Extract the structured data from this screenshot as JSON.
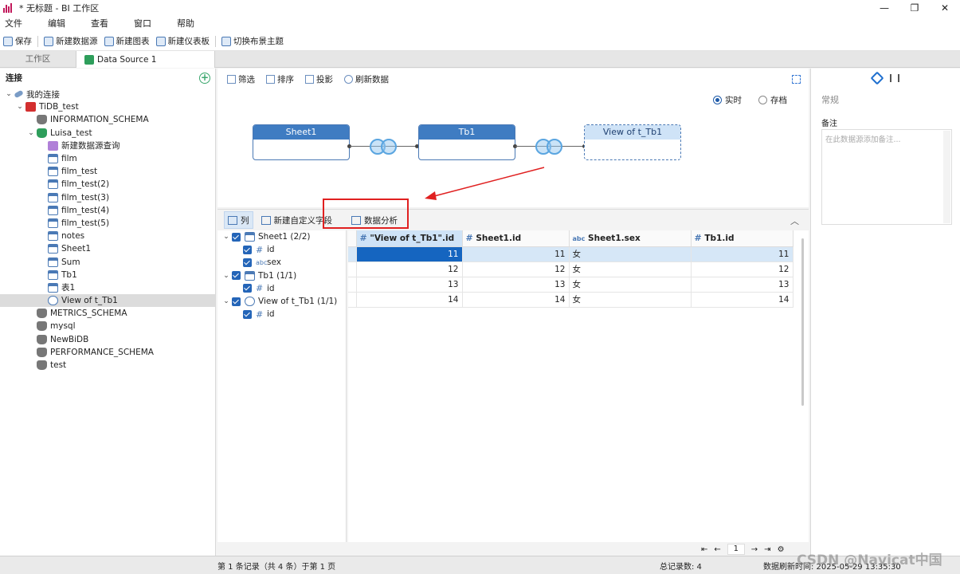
{
  "window": {
    "title": "* 无标题 - BI 工作区",
    "controls": [
      "—",
      "❐",
      "✕"
    ]
  },
  "menu": [
    "文件",
    "编辑",
    "查看",
    "窗口",
    "帮助"
  ],
  "toolbar": {
    "save": "保存",
    "new_datasource": "新建数据源",
    "new_chart": "新建图表",
    "new_dashboard": "新建仪表板",
    "switch_theme": "切换布景主题"
  },
  "tabs": {
    "workspace": "工作区",
    "datasource": "Data Source 1"
  },
  "left": {
    "header": "连接",
    "plus": "+",
    "tree": [
      {
        "label": "我的连接",
        "icon": "connection-icon",
        "level": 0,
        "exp": "⌄"
      },
      {
        "label": "TiDB_test",
        "icon": "tidb-icon",
        "level": 1,
        "exp": "⌄"
      },
      {
        "label": "INFORMATION_SCHEMA",
        "icon": "database-icon",
        "level": 2,
        "exp": ""
      },
      {
        "label": "Luisa_test",
        "icon": "database-green-icon",
        "level": 2,
        "exp": "⌄"
      },
      {
        "label": "新建数据源查询",
        "icon": "query-icon",
        "level": 3,
        "exp": ""
      },
      {
        "label": "film",
        "icon": "table-icon",
        "level": 3,
        "exp": ""
      },
      {
        "label": "film_test",
        "icon": "table-icon",
        "level": 3,
        "exp": ""
      },
      {
        "label": "film_test(2)",
        "icon": "table-icon",
        "level": 3,
        "exp": ""
      },
      {
        "label": "film_test(3)",
        "icon": "table-icon",
        "level": 3,
        "exp": ""
      },
      {
        "label": "film_test(4)",
        "icon": "table-icon",
        "level": 3,
        "exp": ""
      },
      {
        "label": "film_test(5)",
        "icon": "table-icon",
        "level": 3,
        "exp": ""
      },
      {
        "label": "notes",
        "icon": "table-icon",
        "level": 3,
        "exp": ""
      },
      {
        "label": "Sheet1",
        "icon": "table-icon",
        "level": 3,
        "exp": ""
      },
      {
        "label": "Sum",
        "icon": "table-icon",
        "level": 3,
        "exp": ""
      },
      {
        "label": "Tb1",
        "icon": "table-icon",
        "level": 3,
        "exp": ""
      },
      {
        "label": "表1",
        "icon": "table-icon",
        "level": 3,
        "exp": ""
      },
      {
        "label": "View of t_Tb1",
        "icon": "view-icon",
        "level": 3,
        "exp": "",
        "selected": true
      },
      {
        "label": "METRICS_SCHEMA",
        "icon": "database-icon",
        "level": 2,
        "exp": ""
      },
      {
        "label": "mysql",
        "icon": "database-icon",
        "level": 2,
        "exp": ""
      },
      {
        "label": "NewBiDB",
        "icon": "database-icon",
        "level": 2,
        "exp": ""
      },
      {
        "label": "PERFORMANCE_SCHEMA",
        "icon": "database-icon",
        "level": 2,
        "exp": ""
      },
      {
        "label": "test",
        "icon": "database-icon",
        "level": 2,
        "exp": ""
      }
    ]
  },
  "center": {
    "toolbar": {
      "filter": "筛选",
      "sort": "排序",
      "project": "投影",
      "refresh": "刷新数据"
    },
    "mode": {
      "realtime": "实时",
      "archive": "存档",
      "selected": "realtime"
    },
    "nodes": {
      "sheet1": "Sheet1",
      "tb1": "Tb1",
      "view": "View of t_Tb1"
    },
    "lower_toolbar": {
      "columns": "列",
      "new_custom_field": "新建自定义字段",
      "data_analysis": "数据分析",
      "collapse": "︿"
    },
    "fieldtree": [
      {
        "label": "Sheet1 (2/2)",
        "kind": "table",
        "exp": "⌄"
      },
      {
        "label": "id",
        "kind": "num"
      },
      {
        "label": "sex",
        "kind": "str"
      },
      {
        "label": "Tb1 (1/1)",
        "kind": "table",
        "exp": "⌄"
      },
      {
        "label": "id",
        "kind": "num"
      },
      {
        "label": "View of t_Tb1 (1/1)",
        "kind": "view",
        "exp": "⌄"
      },
      {
        "label": "id",
        "kind": "num"
      }
    ],
    "grid": {
      "headers": [
        "\"View of t_Tb1\".id",
        "Sheet1.id",
        "Sheet1.sex",
        "Tb1.id"
      ],
      "header_marks": [
        "#",
        "#",
        "abc",
        "#"
      ],
      "rows": [
        [
          "11",
          "11",
          "女",
          "11"
        ],
        [
          "12",
          "12",
          "女",
          "12"
        ],
        [
          "13",
          "13",
          "女",
          "13"
        ],
        [
          "14",
          "14",
          "女",
          "14"
        ]
      ]
    },
    "pager": {
      "first": "⇤",
      "prev": "←",
      "page": "1",
      "next": "→",
      "last": "⇥",
      "settings": "⚙"
    }
  },
  "right": {
    "section": "常规",
    "notes_label": "备注",
    "notes_placeholder": "在此数据源添加备注..."
  },
  "status": {
    "record": "第 1 条记录（共 4 条）于第 1 页",
    "total": "总记录数: 4",
    "refresh_time": "数据刷新时间: 2025-05-29 13:35:30"
  },
  "watermark": "CSDN @Navicat中国",
  "colors": {
    "accent": "#1565c0",
    "highlight": "#e02020",
    "node_header": "#3f7cc2"
  }
}
